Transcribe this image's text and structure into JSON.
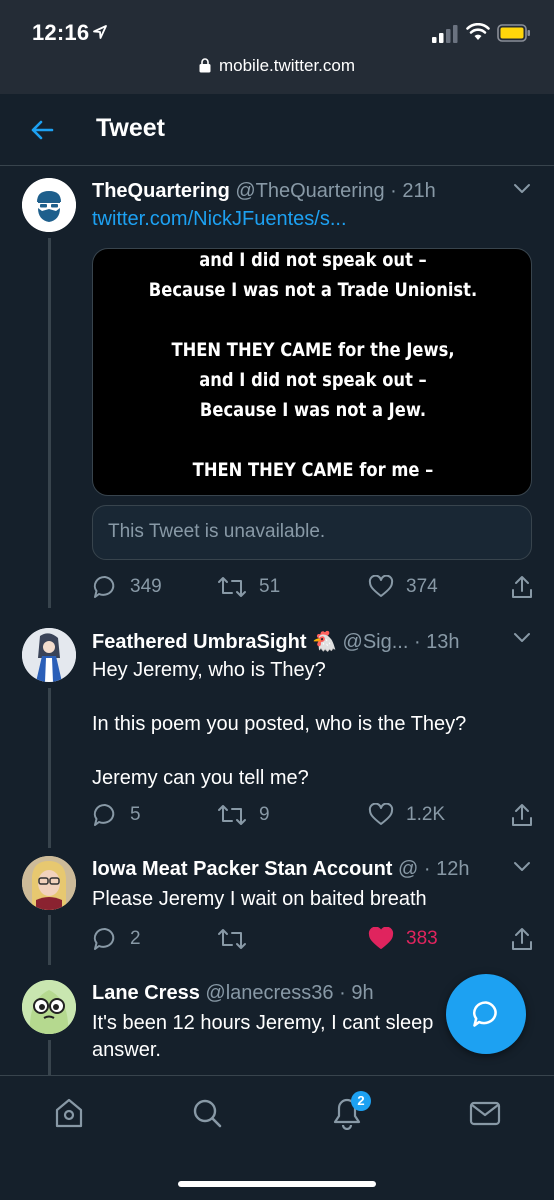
{
  "status": {
    "time": "12:16"
  },
  "browser": {
    "url": "mobile.twitter.com"
  },
  "header": {
    "title": "Tweet"
  },
  "tweets": [
    {
      "name": "TheQuartering",
      "handle": "@TheQuartering · 21h",
      "link": "twitter.com/NickJFuentes/s...",
      "media_text": [
        "and I did not speak out –",
        "Because I was not a Trade Unionist.",
        "",
        "THEN THEY CAME for the Jews,",
        "and I did not speak out –",
        "Because I was not a Jew.",
        "",
        "THEN THEY CAME for me –"
      ],
      "quote_unavailable": "This Tweet is unavailable.",
      "replies": "349",
      "retweets": "51",
      "likes": "374"
    },
    {
      "name": "Feathered UmbraSight 🐔",
      "handle": "@Sig... · 13h",
      "text_lines": [
        "Hey Jeremy, who is They?",
        "",
        "In this poem you posted, who is the They?",
        "",
        "Jeremy can you tell me?"
      ],
      "replies": "5",
      "retweets": "9",
      "likes": "1.2K"
    },
    {
      "name": "Iowa Meat Packer Stan Account",
      "handle": "@ · 12h",
      "text_lines": [
        "Please Jeremy I wait on baited breath"
      ],
      "replies": "2",
      "retweets": "",
      "likes": "383",
      "liked": true
    },
    {
      "name": "Lane Cress",
      "handle": "@lanecress36 · 9h",
      "text_lines": [
        "It's been 12 hours Jeremy, I cant sleep",
        "answer."
      ]
    }
  ],
  "nav": {
    "notifications_badge": "2"
  },
  "colors": {
    "accent": "#1da1f2",
    "background": "#15202b",
    "like": "#e0245e",
    "muted": "#8899a6"
  }
}
